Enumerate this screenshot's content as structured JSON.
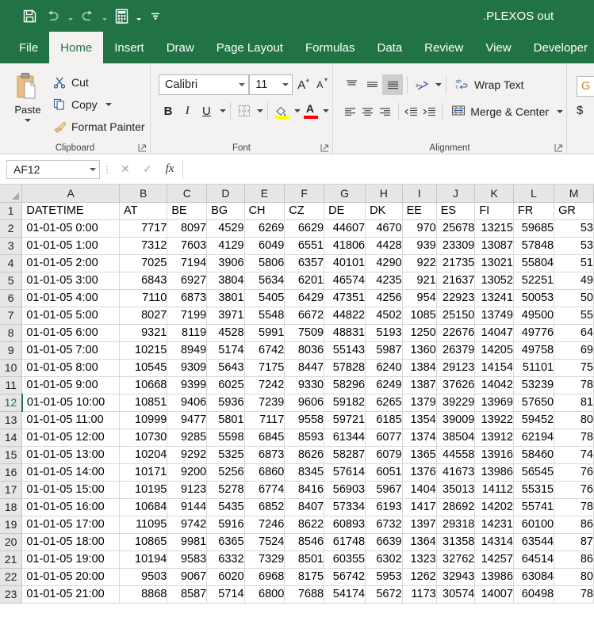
{
  "titlebar": {
    "document_title": ".PLEXOS out",
    "quick_access": [
      {
        "name": "save",
        "icon": "save-icon"
      },
      {
        "name": "undo",
        "icon": "undo-icon"
      },
      {
        "name": "redo",
        "icon": "redo-icon"
      },
      {
        "name": "calculate",
        "icon": "calculator-icon"
      },
      {
        "name": "customize",
        "icon": "customize-quick-access-icon"
      }
    ],
    "accent_color": "#217346"
  },
  "tabs": [
    {
      "label": "File",
      "active": false
    },
    {
      "label": "Home",
      "active": true
    },
    {
      "label": "Insert",
      "active": false
    },
    {
      "label": "Draw",
      "active": false
    },
    {
      "label": "Page Layout",
      "active": false
    },
    {
      "label": "Formulas",
      "active": false
    },
    {
      "label": "Data",
      "active": false
    },
    {
      "label": "Review",
      "active": false
    },
    {
      "label": "View",
      "active": false
    },
    {
      "label": "Developer",
      "active": false
    }
  ],
  "ribbon": {
    "clipboard": {
      "group_label": "Clipboard",
      "paste_label": "Paste",
      "cut_label": "Cut",
      "copy_label": "Copy",
      "format_painter_label": "Format Painter"
    },
    "font": {
      "group_label": "Font",
      "font_family_value": "Calibri",
      "font_size_value": "11",
      "bold_label": "B",
      "italic_label": "I",
      "underline_label": "U",
      "grow_font_label": "A",
      "shrink_font_label": "A",
      "highlight_color": "#ffff00",
      "font_color": "#ff0000"
    },
    "alignment": {
      "group_label": "Alignment",
      "wrap_text_label": "Wrap Text",
      "merge_center_label": "Merge & Center"
    },
    "number": {
      "format_value": "G"
    }
  },
  "formula_bar": {
    "name_box_value": "AF12",
    "cancel_label": "✕",
    "enter_label": "✓",
    "function_label": "fx",
    "formula_value": ""
  },
  "grid": {
    "columns": [
      "A",
      "B",
      "C",
      "D",
      "E",
      "F",
      "G",
      "H",
      "I",
      "J",
      "K",
      "L",
      "M"
    ],
    "active_row": 12,
    "headers": [
      "DATETIME",
      "AT",
      "BE",
      "BG",
      "CH",
      "CZ",
      "DE",
      "DK",
      "EE",
      "ES",
      "FI",
      "FR",
      "GR"
    ],
    "rows": [
      {
        "n": 1,
        "cells": [
          "DATETIME",
          "AT",
          "BE",
          "BG",
          "CH",
          "CZ",
          "DE",
          "DK",
          "EE",
          "ES",
          "FI",
          "FR",
          "GR"
        ],
        "is_header": true
      },
      {
        "n": 2,
        "cells": [
          "01-01-05 0:00",
          "7717",
          "8097",
          "4529",
          "6269",
          "6629",
          "44607",
          "4670",
          "970",
          "25678",
          "13215",
          "59685",
          "53"
        ]
      },
      {
        "n": 3,
        "cells": [
          "01-01-05 1:00",
          "7312",
          "7603",
          "4129",
          "6049",
          "6551",
          "41806",
          "4428",
          "939",
          "23309",
          "13087",
          "57848",
          "53"
        ]
      },
      {
        "n": 4,
        "cells": [
          "01-01-05 2:00",
          "7025",
          "7194",
          "3906",
          "5806",
          "6357",
          "40101",
          "4290",
          "922",
          "21735",
          "13021",
          "55804",
          "51"
        ]
      },
      {
        "n": 5,
        "cells": [
          "01-01-05 3:00",
          "6843",
          "6927",
          "3804",
          "5634",
          "6201",
          "46574",
          "4235",
          "921",
          "21637",
          "13052",
          "52251",
          "49"
        ]
      },
      {
        "n": 6,
        "cells": [
          "01-01-05 4:00",
          "7110",
          "6873",
          "3801",
          "5405",
          "6429",
          "47351",
          "4256",
          "954",
          "22923",
          "13241",
          "50053",
          "50"
        ]
      },
      {
        "n": 7,
        "cells": [
          "01-01-05 5:00",
          "8027",
          "7199",
          "3971",
          "5548",
          "6672",
          "44822",
          "4502",
          "1085",
          "25150",
          "13749",
          "49500",
          "55"
        ]
      },
      {
        "n": 8,
        "cells": [
          "01-01-05 6:00",
          "9321",
          "8119",
          "4528",
          "5991",
          "7509",
          "48831",
          "5193",
          "1250",
          "22676",
          "14047",
          "49776",
          "64"
        ]
      },
      {
        "n": 9,
        "cells": [
          "01-01-05 7:00",
          "10215",
          "8949",
          "5174",
          "6742",
          "8036",
          "55143",
          "5987",
          "1360",
          "26379",
          "14205",
          "49758",
          "69"
        ]
      },
      {
        "n": 10,
        "cells": [
          "01-01-05 8:00",
          "10545",
          "9309",
          "5643",
          "7175",
          "8447",
          "57828",
          "6240",
          "1384",
          "29123",
          "14154",
          "51101",
          "75"
        ]
      },
      {
        "n": 11,
        "cells": [
          "01-01-05 9:00",
          "10668",
          "9399",
          "6025",
          "7242",
          "9330",
          "58296",
          "6249",
          "1387",
          "37626",
          "14042",
          "53239",
          "78"
        ]
      },
      {
        "n": 12,
        "cells": [
          "01-01-05 10:00",
          "10851",
          "9406",
          "5936",
          "7239",
          "9606",
          "59182",
          "6265",
          "1379",
          "39229",
          "13969",
          "57650",
          "81"
        ],
        "active": true
      },
      {
        "n": 13,
        "cells": [
          "01-01-05 11:00",
          "10999",
          "9477",
          "5801",
          "7117",
          "9558",
          "59721",
          "6185",
          "1354",
          "39009",
          "13922",
          "59452",
          "80"
        ]
      },
      {
        "n": 14,
        "cells": [
          "01-01-05 12:00",
          "10730",
          "9285",
          "5598",
          "6845",
          "8593",
          "61344",
          "6077",
          "1374",
          "38504",
          "13912",
          "62194",
          "78"
        ]
      },
      {
        "n": 15,
        "cells": [
          "01-01-05 13:00",
          "10204",
          "9292",
          "5325",
          "6873",
          "8626",
          "58287",
          "6079",
          "1365",
          "44558",
          "13916",
          "58460",
          "74"
        ]
      },
      {
        "n": 16,
        "cells": [
          "01-01-05 14:00",
          "10171",
          "9200",
          "5256",
          "6860",
          "8345",
          "57614",
          "6051",
          "1376",
          "41673",
          "13986",
          "56545",
          "76"
        ]
      },
      {
        "n": 17,
        "cells": [
          "01-01-05 15:00",
          "10195",
          "9123",
          "5278",
          "6774",
          "8416",
          "56903",
          "5967",
          "1404",
          "35013",
          "14112",
          "55315",
          "76"
        ]
      },
      {
        "n": 18,
        "cells": [
          "01-01-05 16:00",
          "10684",
          "9144",
          "5435",
          "6852",
          "8407",
          "57334",
          "6193",
          "1417",
          "28692",
          "14202",
          "55741",
          "78"
        ]
      },
      {
        "n": 19,
        "cells": [
          "01-01-05 17:00",
          "11095",
          "9742",
          "5916",
          "7246",
          "8622",
          "60893",
          "6732",
          "1397",
          "29318",
          "14231",
          "60100",
          "86"
        ]
      },
      {
        "n": 20,
        "cells": [
          "01-01-05 18:00",
          "10865",
          "9981",
          "6365",
          "7524",
          "8546",
          "61748",
          "6639",
          "1364",
          "31358",
          "14314",
          "63544",
          "87"
        ]
      },
      {
        "n": 21,
        "cells": [
          "01-01-05 19:00",
          "10194",
          "9583",
          "6332",
          "7329",
          "8501",
          "60355",
          "6302",
          "1323",
          "32762",
          "14257",
          "64514",
          "86"
        ]
      },
      {
        "n": 22,
        "cells": [
          "01-01-05 20:00",
          "9503",
          "9067",
          "6020",
          "6968",
          "8175",
          "56742",
          "5953",
          "1262",
          "32943",
          "13986",
          "63084",
          "80"
        ]
      },
      {
        "n": 23,
        "cells": [
          "01-01-05 21:00",
          "8868",
          "8587",
          "5714",
          "6800",
          "7688",
          "54174",
          "5672",
          "1173",
          "30574",
          "14007",
          "60498",
          "78"
        ]
      }
    ]
  }
}
